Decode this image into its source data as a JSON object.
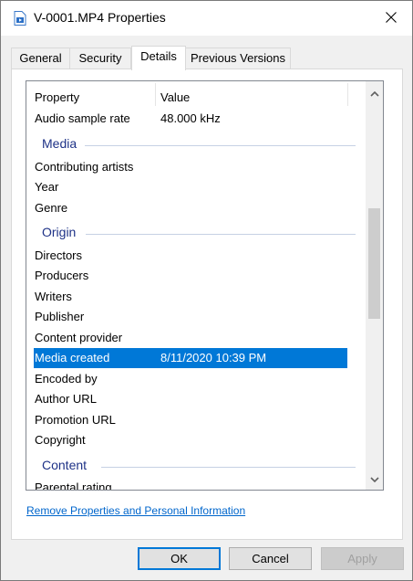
{
  "window": {
    "title": "V-0001.MP4 Properties"
  },
  "tabs": [
    {
      "label": "General"
    },
    {
      "label": "Security"
    },
    {
      "label": "Details"
    },
    {
      "label": "Previous Versions"
    }
  ],
  "list": {
    "header": {
      "property": "Property",
      "value": "Value"
    },
    "rows": [
      {
        "property": "Audio sample rate",
        "value": "48.000 kHz"
      }
    ],
    "media_group": "Media",
    "media_rows": [
      {
        "property": "Contributing artists",
        "value": ""
      },
      {
        "property": "Year",
        "value": ""
      },
      {
        "property": "Genre",
        "value": ""
      }
    ],
    "origin_group": "Origin",
    "origin_rows": [
      {
        "property": "Directors",
        "value": ""
      },
      {
        "property": "Producers",
        "value": ""
      },
      {
        "property": "Writers",
        "value": ""
      },
      {
        "property": "Publisher",
        "value": ""
      },
      {
        "property": "Content provider",
        "value": ""
      },
      {
        "property": "Media created",
        "value": "8/11/2020 10:39 PM"
      },
      {
        "property": "Encoded by",
        "value": ""
      },
      {
        "property": "Author URL",
        "value": ""
      },
      {
        "property": "Promotion URL",
        "value": ""
      },
      {
        "property": "Copyright",
        "value": ""
      }
    ],
    "content_group": "Content",
    "content_rows": [
      {
        "property": "Parental rating",
        "value": ""
      }
    ]
  },
  "remove_link": "Remove Properties and Personal Information",
  "buttons": {
    "ok": "OK",
    "cancel": "Cancel",
    "apply": "Apply"
  },
  "colors": {
    "selection": "#0078d7",
    "group_header": "#1e3287",
    "link": "#0066cc"
  },
  "icons": {
    "title": "video-file-icon",
    "close": "close-icon",
    "scroll_up": "chevron-up-icon",
    "scroll_down": "chevron-down-icon"
  }
}
